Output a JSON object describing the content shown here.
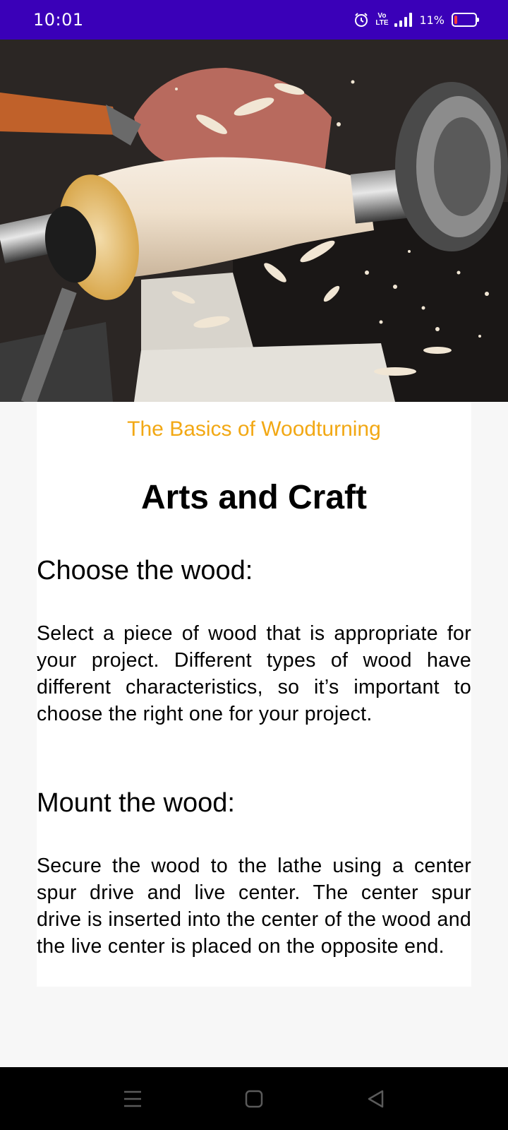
{
  "status_bar": {
    "time": "10:01",
    "volte_label": "Vo\nLTE",
    "battery_percent": "11%",
    "battery_level": 0.11,
    "bg_color": "#3a00b8"
  },
  "hero": {
    "image_name": "wood-lathe-photo"
  },
  "article": {
    "subtitle": "The Basics of Woodturning",
    "title": "Arts and Craft",
    "sections": [
      {
        "heading": "Choose the wood:",
        "body": "Select a piece of wood that is appropriate for your project. Different types of wood have different characteristics, so it’s important to choose the right one for your project."
      },
      {
        "heading": "Mount the wood:",
        "body": "Secure the wood to the lathe using a center spur drive and live center. The center spur drive is inserted into the center of the wood and the live center is placed on the opposite end."
      }
    ],
    "accent_color": "#f2a814"
  },
  "nav_bar": {
    "buttons": [
      "menu-icon",
      "home-icon",
      "back-icon"
    ]
  }
}
